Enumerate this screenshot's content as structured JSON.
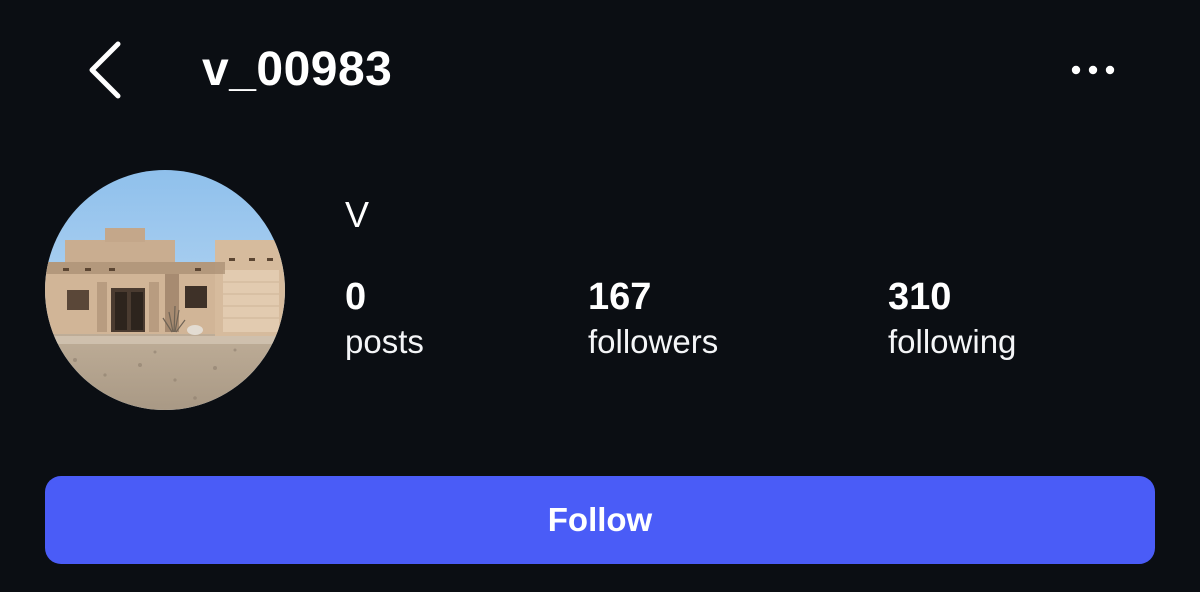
{
  "header": {
    "username": "v_00983",
    "back_icon": "chevron-left-icon",
    "more_icon": "more-horizontal-icon"
  },
  "profile": {
    "display_name": "V",
    "avatar_description": "adobe-style house photo"
  },
  "stats": [
    {
      "value": "0",
      "label": "posts"
    },
    {
      "value": "167",
      "label": "followers"
    },
    {
      "value": "310",
      "label": "following"
    }
  ],
  "actions": {
    "follow_label": "Follow"
  },
  "colors": {
    "background": "#0b0e13",
    "accent": "#4a5cf7",
    "text": "#ffffff"
  }
}
